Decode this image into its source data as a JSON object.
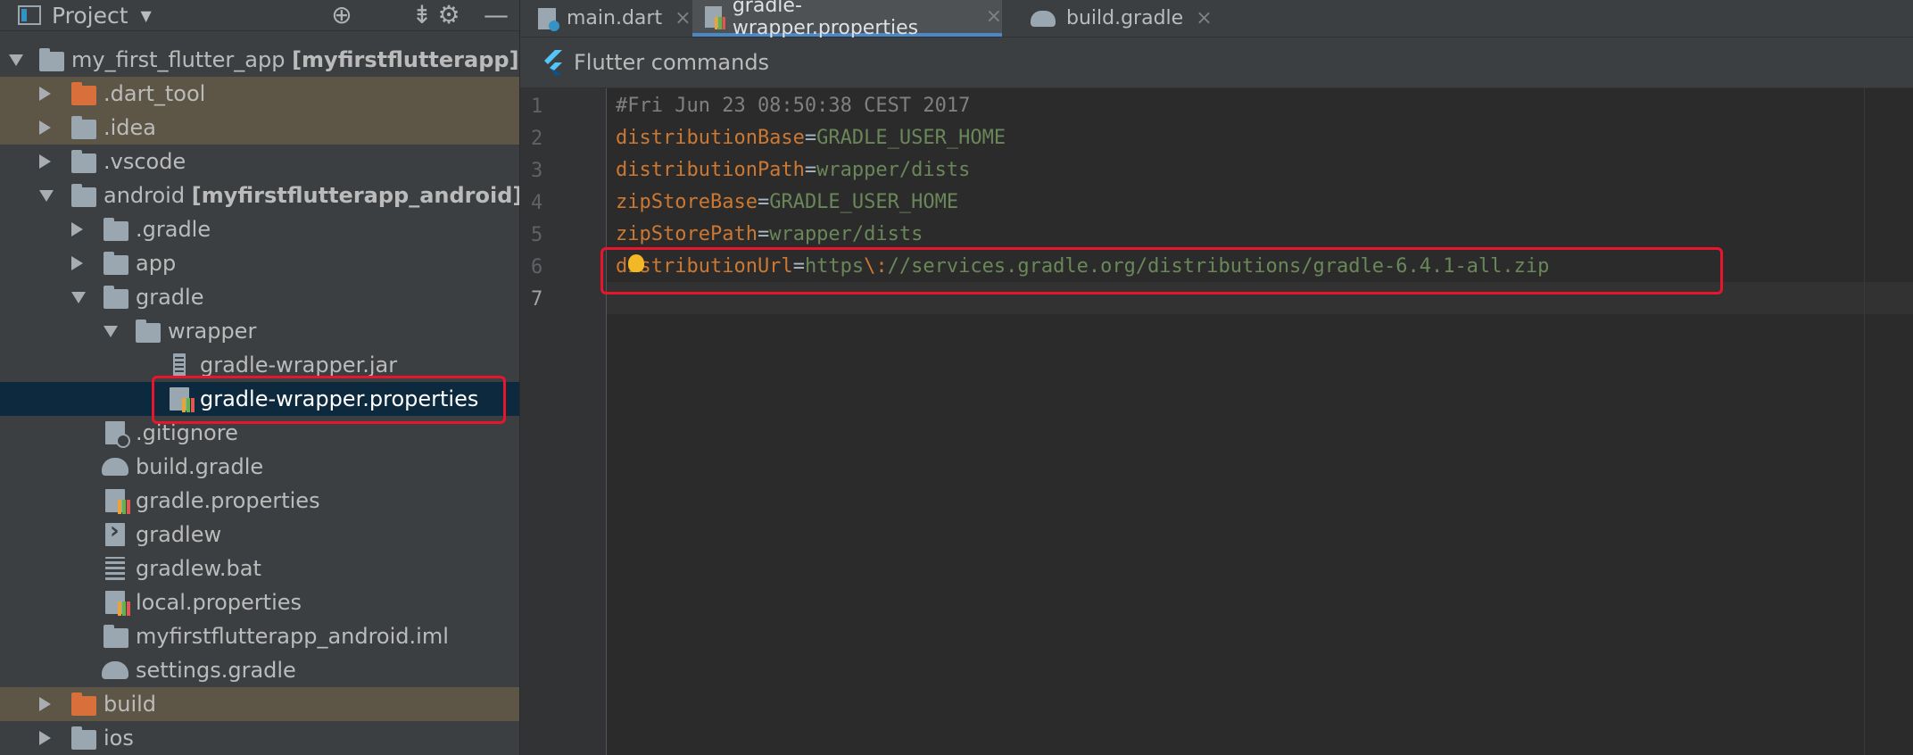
{
  "project_panel": {
    "title": "Project",
    "tree": [
      {
        "label": "my_first_flutter_app",
        "suffix": "[myfirstflutterapp]",
        "path": "~/"
      },
      {
        "label": ".dart_tool"
      },
      {
        "label": ".idea"
      },
      {
        "label": ".vscode"
      },
      {
        "label": "android",
        "suffix": "[myfirstflutterapp_android]"
      },
      {
        "label": ".gradle"
      },
      {
        "label": "app"
      },
      {
        "label": "gradle"
      },
      {
        "label": "wrapper"
      },
      {
        "label": "gradle-wrapper.jar"
      },
      {
        "label": "gradle-wrapper.properties"
      },
      {
        "label": ".gitignore"
      },
      {
        "label": "build.gradle"
      },
      {
        "label": "gradle.properties"
      },
      {
        "label": "gradlew"
      },
      {
        "label": "gradlew.bat"
      },
      {
        "label": "local.properties"
      },
      {
        "label": "myfirstflutterapp_android.iml"
      },
      {
        "label": "settings.gradle"
      },
      {
        "label": "build"
      },
      {
        "label": "ios"
      }
    ]
  },
  "tabs": [
    {
      "label": "main.dart"
    },
    {
      "label": "gradle-wrapper.properties"
    },
    {
      "label": "build.gradle"
    }
  ],
  "tab_close_glyph": "×",
  "flutter_bar": {
    "label": "Flutter commands"
  },
  "editor": {
    "line_numbers": [
      "1",
      "2",
      "3",
      "4",
      "5",
      "6",
      "7"
    ],
    "lines": [
      {
        "text": "#Fri Jun 23 08:50:38 CEST 2017"
      },
      {
        "key": "distributionBase",
        "eq": "=",
        "value": "GRADLE_USER_HOME"
      },
      {
        "key": "distributionPath",
        "eq": "=",
        "value": "wrapper/dists"
      },
      {
        "key": "zipStoreBase",
        "eq": "=",
        "value": "GRADLE_USER_HOME"
      },
      {
        "key": "zipStorePath",
        "eq": "=",
        "value": "wrapper/dists"
      },
      {
        "key": "distributionUrl",
        "eq": "=",
        "value_a": "https",
        "escape": "\\:",
        "value_b": "//services.gradle.org/distributions/gradle-6.4.1-all.zip"
      }
    ]
  },
  "colors": {
    "key": "#cc7832",
    "value": "#6a8759",
    "comment": "#808080",
    "highlight": "#e8152d",
    "active_tab_underline": "#4a88c7"
  }
}
